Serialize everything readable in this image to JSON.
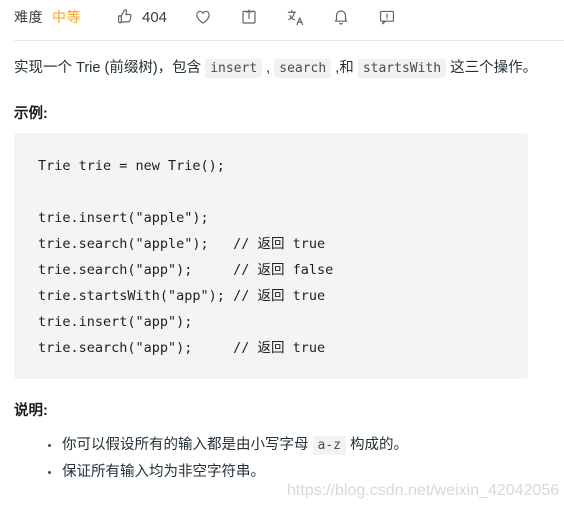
{
  "toolbar": {
    "difficulty_label": "难度",
    "difficulty_value": "中等",
    "difficulty_color": "#ffa116",
    "like_count": "404",
    "icons": {
      "thumbs_up": "thumbs-up-icon",
      "favorite": "heart-icon",
      "share": "share-icon",
      "translate": "translate-icon",
      "notification": "bell-icon",
      "comment": "comment-icon"
    }
  },
  "description": {
    "text_1": "实现一个 Trie (前缀树)，包含 ",
    "code_1": "insert",
    "text_2": " , ",
    "code_2": "search",
    "text_3": " ,和 ",
    "code_3": "startsWith",
    "text_4": " 这三个操作。"
  },
  "example": {
    "title": "示例:",
    "code_lines": [
      "Trie trie = new Trie();",
      "",
      "trie.insert(\"apple\");",
      "trie.search(\"apple\");   // 返回 true",
      "trie.search(\"app\");     // 返回 false",
      "trie.startsWith(\"app\"); // 返回 true",
      "trie.insert(\"app\");",
      "trie.search(\"app\");     // 返回 true"
    ]
  },
  "notes": {
    "title": "说明:",
    "items": [
      {
        "text_1": "你可以假设所有的输入都是由小写字母 ",
        "code": "a-z",
        "text_2": " 构成的。"
      },
      {
        "text_1": "保证所有输入均为非空字符串。",
        "code": "",
        "text_2": ""
      }
    ]
  },
  "watermark": {
    "text": "https://blog.csdn.net/weixin_42042056"
  }
}
